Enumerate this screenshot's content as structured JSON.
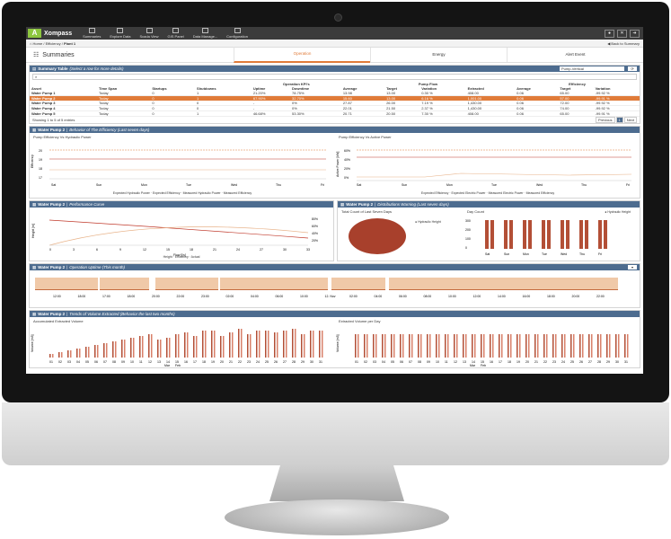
{
  "app": {
    "brand": "Xompass",
    "logo_letter": "A"
  },
  "nav": [
    "Summaries",
    "Explore Data",
    "Scada View",
    "GIS Panel",
    "Data Manage...",
    "Configuration"
  ],
  "breadcrumb": {
    "home": "Home",
    "sep1": "/",
    "section": "Efficiency",
    "sep2": "/",
    "current": "Plant 1",
    "back": "Back to Summary"
  },
  "page": {
    "title": "Summaries"
  },
  "tabs": [
    "Operation",
    "Energy",
    "Alert Event"
  ],
  "summary": {
    "title": "Summary Table",
    "subtitle": "(Select a row for more details)",
    "select_value": "Pump-Vertical",
    "search_placeholder": "",
    "group_headers": [
      "Operation KPI's",
      "Pump Flow",
      "Efficiency"
    ],
    "columns": [
      "Asset",
      "Time Span",
      "Startups",
      "Shutdowns",
      "Uptime",
      "Downtime",
      "Average",
      "Target",
      "Variation",
      "Extracted",
      "Average",
      "Target",
      "Variation"
    ],
    "rows": [
      [
        "Water Pump 1",
        "Today",
        "0",
        "1",
        "21.20%",
        "78.75%",
        "13.98",
        "13.00",
        "0.30 %",
        "408.00",
        "0.06",
        "65.00",
        "-99.92 %"
      ],
      [
        "Water Pump 2",
        "Today",
        "0",
        "1",
        "67.90%",
        "32.70%",
        "15.60",
        "13.00",
        "6.16 %",
        "1,001.00",
        "0.06",
        "57.00",
        "-99.91 %"
      ],
      [
        "Water Pump 3",
        "Today",
        "0",
        "0",
        "-",
        "0%",
        "27.87",
        "26.00",
        "7.19 %",
        "1,430.00",
        "0.06",
        "72.00",
        "-99.92 %"
      ],
      [
        "Water Pump 4",
        "Today",
        "0",
        "0",
        "-",
        "0%",
        "22.01",
        "21.50",
        "2.37 %",
        "1,430.00",
        "0.06",
        "74.00",
        "-99.92 %"
      ],
      [
        "Water Pump 5",
        "Today",
        "0",
        "1",
        "46.68%",
        "53.30%",
        "20.71",
        "20.50",
        "7.30 %",
        "408.00",
        "0.06",
        "65.00",
        "-99.91 %"
      ]
    ],
    "footer": "Showing 1 to 5 of 5 entries",
    "pager": [
      "Previous",
      "1",
      "Next"
    ]
  },
  "behavior": {
    "title": "Water Pump 2",
    "subtitle": "Behavior of The Efficiency (Last seven days)",
    "left_title": "Pump Efficiency Vs Hydraulic Power",
    "right_title": "Pump Efficiency Vs Active Power",
    "left_legend": [
      "Expected Hydraulic Power",
      "Expected Efficiency",
      "Measured Hydraulic Power",
      "Measured Efficiency"
    ],
    "right_legend": [
      "Expected Efficiency",
      "Expected Electric Power",
      "Measured Electric Power",
      "Measured Efficiency"
    ],
    "days": [
      "Sat",
      "Sun",
      "Mon",
      "Tue",
      "Wed",
      "Thu",
      "Fri"
    ],
    "left_yticks": [
      "20",
      "19",
      "18",
      "17"
    ],
    "right_yticks": [
      "60%",
      "40%",
      "20%",
      "0%"
    ],
    "left_ylabel": "Efficiency",
    "right_ylabel": "Active Power [kW]"
  },
  "perf": {
    "title": "Water Pump 2",
    "subtitle": "Performance Curve",
    "xticks": [
      "0",
      "3",
      "6",
      "9",
      "12",
      "15",
      "18",
      "21",
      "24",
      "27",
      "30",
      "33"
    ],
    "ylabel": "Height [m]",
    "xlabel": "Flow [l/s]",
    "right_ticks": [
      "80%",
      "60%",
      "40%",
      "20%"
    ],
    "legend": [
      "Height",
      "Efficiency",
      "Actual"
    ]
  },
  "distrib": {
    "title": "Water Pump 2",
    "subtitle": "Distributions Warning (Last seven days)",
    "pie_title": "Total Count of Last Seven Days",
    "pie_legend": "Hydraulic Height",
    "bar_title": "Day Count",
    "bar_legend": "Hydraulic Height",
    "bar_days": [
      "Sat",
      "Sun",
      "Mon",
      "Tue",
      "Wed",
      "Thu",
      "Fri"
    ],
    "bar_yticks": [
      "300",
      "200",
      "100",
      "0"
    ]
  },
  "uptime": {
    "title": "Water Pump 2",
    "subtitle": "Operation Uptime (This month)",
    "times": [
      "12:00",
      "18:00",
      "17:00",
      "18:00",
      "20:00",
      "22:00",
      "23:00",
      "02:00",
      "04:00",
      "06:00",
      "10:00",
      "12. Nov",
      "02:00",
      "04:00",
      "06:00",
      "08:00",
      "10:00",
      "12:00",
      "14:00",
      "16:00",
      "18:00",
      "20:00",
      "22:00"
    ]
  },
  "trends": {
    "title": "Water Pump 2",
    "subtitle": "Trends of Volume Extracted (Behavior the last two months)",
    "left_title": "Accumulated Extracted Volume",
    "right_title": "Extracted Volume per Day",
    "left_ylabel": "Volume [m3]",
    "right_ylabel": "Volume [m3]",
    "legend": [
      "Mar",
      "Feb"
    ],
    "xticks": [
      "01",
      "02",
      "03",
      "04",
      "05",
      "06",
      "07",
      "08",
      "09",
      "10",
      "11",
      "12",
      "13",
      "14",
      "15",
      "16",
      "17",
      "18",
      "19",
      "20",
      "21",
      "22",
      "23",
      "24",
      "25",
      "26",
      "27",
      "28",
      "29",
      "30",
      "31"
    ]
  },
  "colors": {
    "accent": "#e07b39",
    "header": "#4d6c8f",
    "bar": "#b34f36",
    "pie": "#a8402c",
    "uptime": "#f0c9a8"
  }
}
